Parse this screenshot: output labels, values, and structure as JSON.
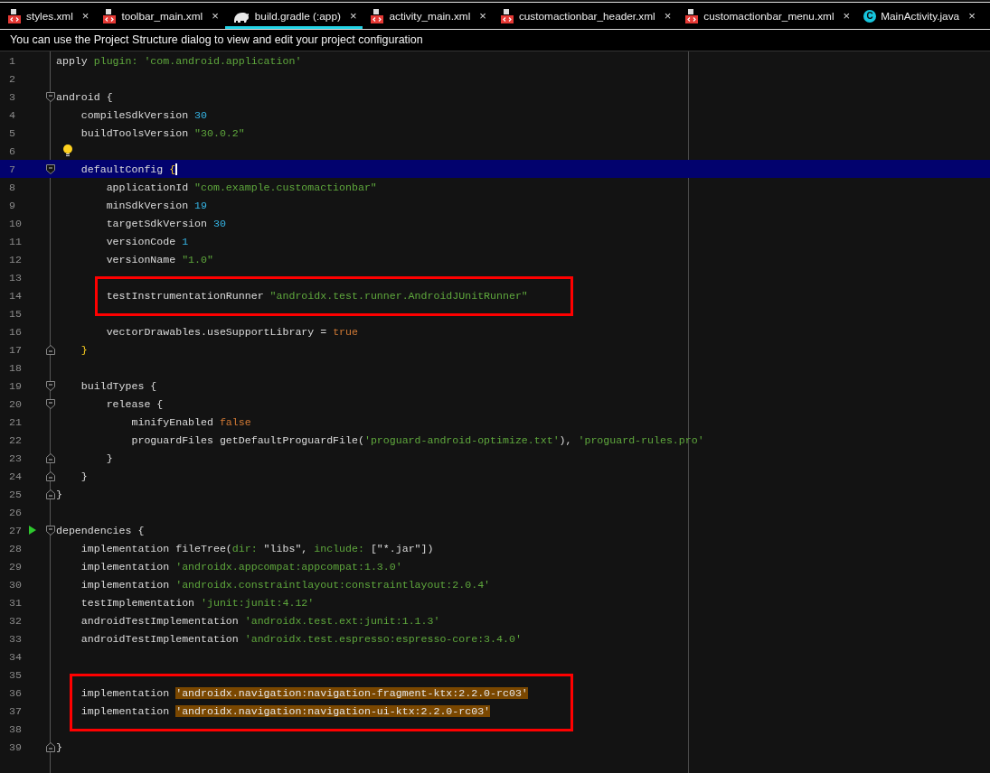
{
  "tabs": [
    {
      "label": "styles.xml",
      "kind": "xml",
      "selected": false
    },
    {
      "label": "toolbar_main.xml",
      "kind": "xml",
      "selected": false
    },
    {
      "label": "build.gradle (:app)",
      "kind": "gradle",
      "selected": true
    },
    {
      "label": "activity_main.xml",
      "kind": "xml",
      "selected": false
    },
    {
      "label": "customactionbar_header.xml",
      "kind": "xml",
      "selected": false
    },
    {
      "label": "customactionbar_menu.xml",
      "kind": "xml",
      "selected": false
    },
    {
      "label": "MainActivity.java",
      "kind": "class",
      "badge": "C",
      "selected": false
    }
  ],
  "close_glyph": "×",
  "notice": "You can use the Project Structure dialog to view and edit your project configuration",
  "lines": [
    {
      "n": "1",
      "tokens": [
        {
          "kind": "text",
          "text": "apply "
        },
        {
          "kind": "string",
          "text": "plugin: 'com.android.application'"
        }
      ]
    },
    {
      "n": "2"
    },
    {
      "n": "3",
      "fold_open": true,
      "tokens": [
        {
          "kind": "text",
          "text": "android {"
        }
      ]
    },
    {
      "n": "4",
      "tokens": [
        {
          "kind": "text",
          "text": "    compileSdkVersion "
        },
        {
          "kind": "number",
          "text": "30"
        }
      ]
    },
    {
      "n": "5",
      "tokens": [
        {
          "kind": "text",
          "text": "    buildToolsVersion "
        },
        {
          "kind": "string",
          "text": "\"30.0.2\""
        }
      ]
    },
    {
      "n": "6",
      "intention_bulb": true
    },
    {
      "n": "7",
      "fold_open": true,
      "current": true,
      "tokens": [
        {
          "kind": "text",
          "text": "    defaultConfig "
        },
        {
          "kind": "match",
          "text": "{"
        }
      ]
    },
    {
      "n": "8",
      "tokens": [
        {
          "kind": "text",
          "text": "        applicationId "
        },
        {
          "kind": "string",
          "text": "\"com.example.customactionbar\""
        }
      ]
    },
    {
      "n": "9",
      "tokens": [
        {
          "kind": "text",
          "text": "        minSdkVersion "
        },
        {
          "kind": "number",
          "text": "19"
        }
      ]
    },
    {
      "n": "10",
      "tokens": [
        {
          "kind": "text",
          "text": "        targetSdkVersion "
        },
        {
          "kind": "number",
          "text": "30"
        }
      ]
    },
    {
      "n": "11",
      "tokens": [
        {
          "kind": "text",
          "text": "        versionCode "
        },
        {
          "kind": "number",
          "text": "1"
        }
      ]
    },
    {
      "n": "12",
      "tokens": [
        {
          "kind": "text",
          "text": "        versionName "
        },
        {
          "kind": "string",
          "text": "\"1.0\""
        }
      ]
    },
    {
      "n": "13",
      "boxed": true
    },
    {
      "n": "14",
      "boxed": true,
      "tokens": [
        {
          "kind": "text",
          "text": "        testInstrumentationRunner "
        },
        {
          "kind": "string",
          "text": "\"androidx.test.runner.AndroidJUnitRunner\""
        }
      ]
    },
    {
      "n": "15",
      "boxed": true
    },
    {
      "n": "16",
      "tokens": [
        {
          "kind": "text",
          "text": "        vectorDrawables.useSupportLibrary = "
        },
        {
          "kind": "keyword",
          "text": "true"
        }
      ]
    },
    {
      "n": "17",
      "fold_close": true,
      "tokens": [
        {
          "kind": "match",
          "text": "    }"
        }
      ]
    },
    {
      "n": "18"
    },
    {
      "n": "19",
      "fold_open": true,
      "tokens": [
        {
          "kind": "text",
          "text": "    buildTypes {"
        }
      ]
    },
    {
      "n": "20",
      "fold_open": true,
      "tokens": [
        {
          "kind": "text",
          "text": "        release {"
        }
      ]
    },
    {
      "n": "21",
      "tokens": [
        {
          "kind": "text",
          "text": "            minifyEnabled "
        },
        {
          "kind": "keyword",
          "text": "false"
        }
      ]
    },
    {
      "n": "22",
      "tokens": [
        {
          "kind": "text",
          "text": "            proguardFiles getDefaultProguardFile("
        },
        {
          "kind": "string",
          "text": "'proguard-android-optimize.txt'"
        },
        {
          "kind": "text",
          "text": "), "
        },
        {
          "kind": "string",
          "text": "'proguard-rules.pro'"
        }
      ]
    },
    {
      "n": "23",
      "fold_close": true,
      "tokens": [
        {
          "kind": "text",
          "text": "        }"
        }
      ]
    },
    {
      "n": "24",
      "fold_close": true,
      "tokens": [
        {
          "kind": "text",
          "text": "    }"
        }
      ]
    },
    {
      "n": "25",
      "fold_close": true,
      "tokens": [
        {
          "kind": "text",
          "text": "}"
        }
      ]
    },
    {
      "n": "26"
    },
    {
      "n": "27",
      "fold_open": true,
      "run_gutter": true,
      "tokens": [
        {
          "kind": "text",
          "text": "dependencies {"
        }
      ]
    },
    {
      "n": "28",
      "tokens": [
        {
          "kind": "text",
          "text": "    implementation fileTree("
        },
        {
          "kind": "string",
          "text": "dir: "
        },
        {
          "kind": "text",
          "text": "\"libs\", "
        },
        {
          "kind": "string",
          "text": "include: "
        },
        {
          "kind": "text",
          "text": "[\"*.jar\"])"
        }
      ]
    },
    {
      "n": "29",
      "tokens": [
        {
          "kind": "text",
          "text": "    implementation "
        },
        {
          "kind": "string",
          "text": "'androidx.appcompat:appcompat:1.3.0'"
        }
      ]
    },
    {
      "n": "30",
      "tokens": [
        {
          "kind": "text",
          "text": "    implementation "
        },
        {
          "kind": "string",
          "text": "'androidx.constraintlayout:constraintlayout:2.0.4'"
        }
      ]
    },
    {
      "n": "31",
      "tokens": [
        {
          "kind": "text",
          "text": "    testImplementation "
        },
        {
          "kind": "string",
          "text": "'junit:junit:4.12'"
        }
      ]
    },
    {
      "n": "32",
      "tokens": [
        {
          "kind": "text",
          "text": "    androidTestImplementation "
        },
        {
          "kind": "string",
          "text": "'androidx.test.ext:junit:1.1.3'"
        }
      ]
    },
    {
      "n": "33",
      "tokens": [
        {
          "kind": "text",
          "text": "    androidTestImplementation "
        },
        {
          "kind": "string",
          "text": "'androidx.test.espresso:espresso-core:3.4.0'"
        }
      ]
    },
    {
      "n": "34"
    },
    {
      "n": "35",
      "boxed": true
    },
    {
      "n": "36",
      "boxed": true,
      "tokens": [
        {
          "kind": "text",
          "text": "    implementation "
        },
        {
          "kind": "highlight",
          "text": "'androidx.navigation:navigation-fragment-ktx:2.2.0-rc03'"
        }
      ]
    },
    {
      "n": "37",
      "boxed": true,
      "tokens": [
        {
          "kind": "text",
          "text": "    implementation "
        },
        {
          "kind": "highlight",
          "text": "'androidx.navigation:navigation-ui-ktx:2.2.0-rc03'"
        }
      ]
    },
    {
      "n": "38",
      "boxed": true
    },
    {
      "n": "39",
      "fold_close": true,
      "tokens": [
        {
          "kind": "text",
          "text": "}"
        }
      ]
    }
  ]
}
